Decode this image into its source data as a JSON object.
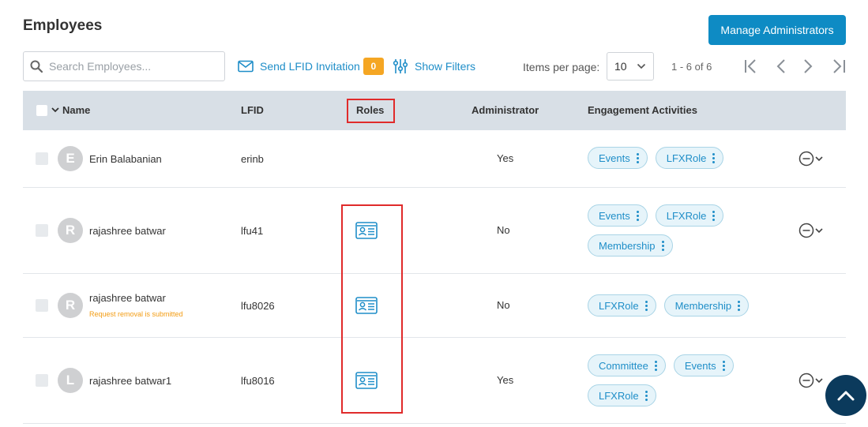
{
  "page": {
    "title": "Employees",
    "manage_admins_label": "Manage Administrators"
  },
  "toolbar": {
    "search_placeholder": "Search Employees...",
    "invite_label": "Send LFID Invitation",
    "invite_count": "0",
    "filters_label": "Show Filters",
    "items_per_page_label": "Items per page:",
    "items_per_page_value": "10",
    "range_text": "1 - 6 of 6"
  },
  "table": {
    "columns": {
      "name": "Name",
      "lfid": "LFID",
      "roles": "Roles",
      "administrator": "Administrator",
      "engagement": "Engagement Activities"
    },
    "rows": [
      {
        "initial": "E",
        "name": "Erin Balabanian",
        "note": "",
        "lfid": "erinb",
        "has_roles": false,
        "admin": "Yes",
        "activities": [
          "Events",
          "LFXRole"
        ]
      },
      {
        "initial": "R",
        "name": "rajashree batwar",
        "note": "",
        "lfid": "lfu41",
        "has_roles": true,
        "admin": "No",
        "activities": [
          "Events",
          "LFXRole",
          "Membership"
        ]
      },
      {
        "initial": "R",
        "name": "rajashree batwar",
        "note": "Request removal is submitted",
        "lfid": "lfu8026",
        "has_roles": true,
        "admin": "No",
        "activities": [
          "LFXRole",
          "Membership"
        ]
      },
      {
        "initial": "L",
        "name": "rajashree batwar1",
        "note": "",
        "lfid": "lfu8016",
        "has_roles": true,
        "admin": "Yes",
        "activities": [
          "Committee",
          "Events",
          "LFXRole"
        ]
      }
    ]
  },
  "icons": {
    "search": "search-icon",
    "mail": "mail-icon",
    "filters": "sliders-icon",
    "role": "id-card-icon",
    "remove": "minus-circle-icon",
    "scroll_top": "chevron-up-icon"
  },
  "colors": {
    "accent": "#0e8bc4",
    "link": "#1f8ec8",
    "badge": "#f5a623",
    "highlight": "#e02b2b",
    "header_bg": "#d8dfe6",
    "scroll_button": "#0b3a5c"
  }
}
